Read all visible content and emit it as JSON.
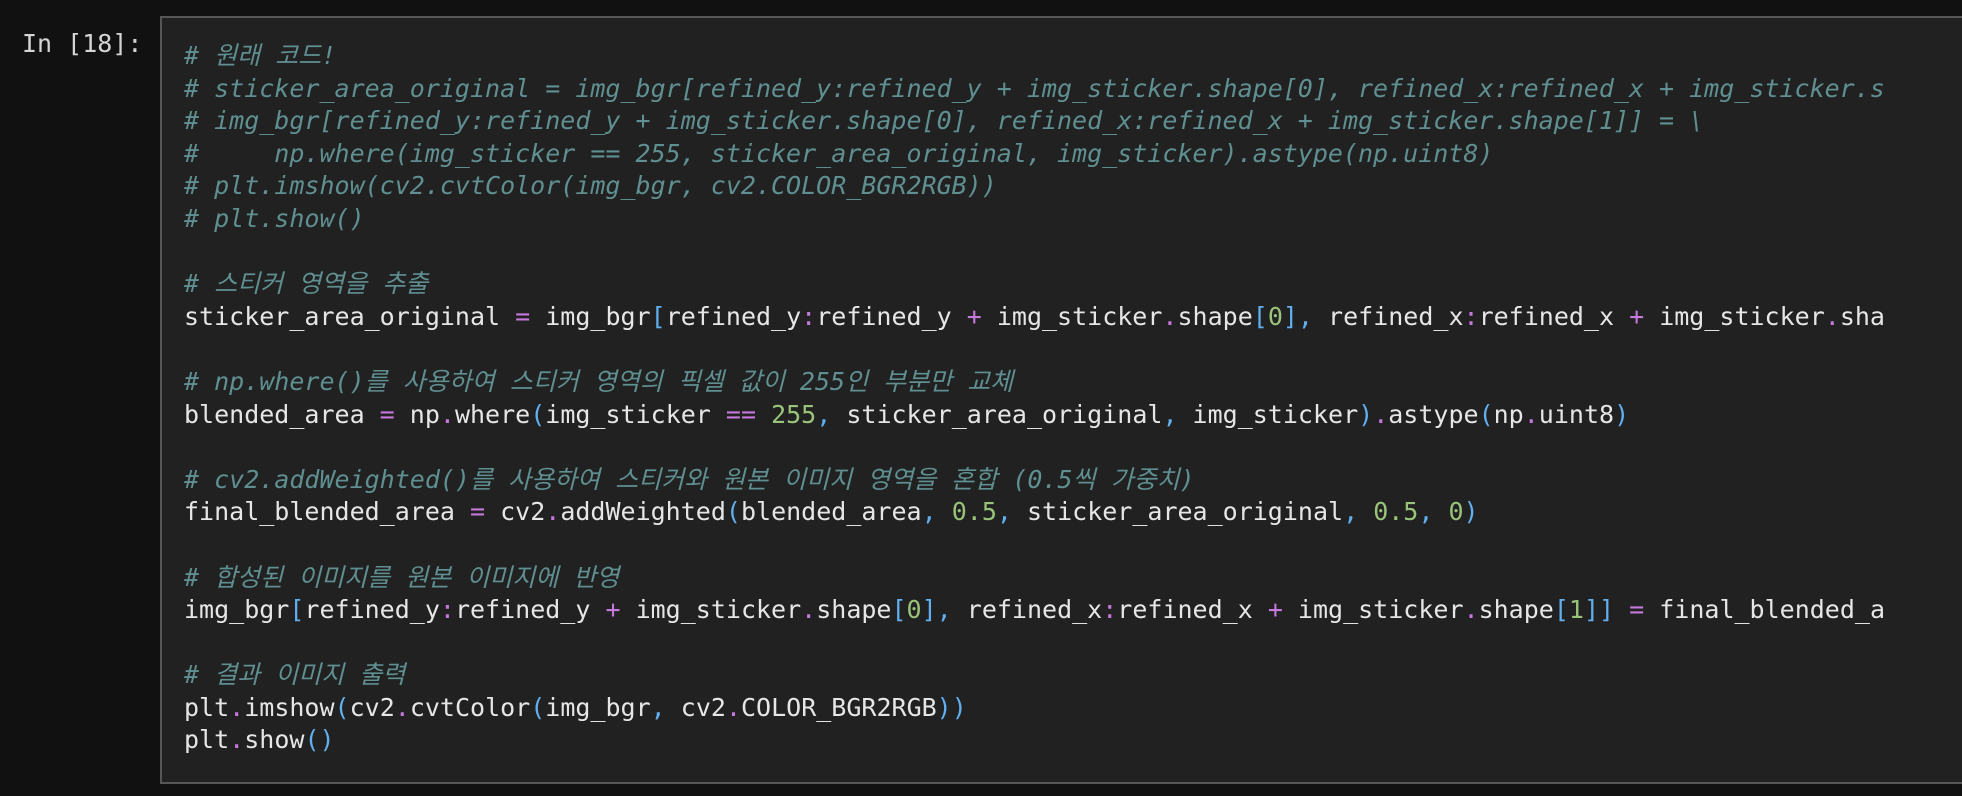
{
  "cell": {
    "prompt": "In [18]:",
    "lines": [
      [
        {
          "t": "# 원래 코드!",
          "c": "cm"
        }
      ],
      [
        {
          "t": "# sticker_area_original = img_bgr[refined_y:refined_y + img_sticker.shape[0], refined_x:refined_x + img_sticker.s",
          "c": "cm"
        }
      ],
      [
        {
          "t": "# img_bgr[refined_y:refined_y + img_sticker.shape[0], refined_x:refined_x + img_sticker.shape[1]] = \\",
          "c": "cm"
        }
      ],
      [
        {
          "t": "#     np.where(img_sticker == 255, sticker_area_original, img_sticker).astype(np.uint8)",
          "c": "cm"
        }
      ],
      [
        {
          "t": "# plt.imshow(cv2.cvtColor(img_bgr, cv2.COLOR_BGR2RGB))",
          "c": "cm"
        }
      ],
      [
        {
          "t": "# plt.show()",
          "c": "cm"
        }
      ],
      [],
      [
        {
          "t": "# 스티커 영역을 추출",
          "c": "cm"
        }
      ],
      [
        {
          "t": "sticker_area_original ",
          "c": ""
        },
        {
          "t": "=",
          "c": "op"
        },
        {
          "t": " img_bgr",
          "c": ""
        },
        {
          "t": "[",
          "c": "br"
        },
        {
          "t": "refined_y",
          "c": ""
        },
        {
          "t": ":",
          "c": "op"
        },
        {
          "t": "refined_y ",
          "c": ""
        },
        {
          "t": "+",
          "c": "op"
        },
        {
          "t": " img_sticker",
          "c": ""
        },
        {
          "t": ".",
          "c": "dot"
        },
        {
          "t": "shape",
          "c": ""
        },
        {
          "t": "[",
          "c": "br"
        },
        {
          "t": "0",
          "c": "num"
        },
        {
          "t": "],",
          "c": "br"
        },
        {
          "t": " refined_x",
          "c": ""
        },
        {
          "t": ":",
          "c": "op"
        },
        {
          "t": "refined_x ",
          "c": ""
        },
        {
          "t": "+",
          "c": "op"
        },
        {
          "t": " img_sticker",
          "c": ""
        },
        {
          "t": ".",
          "c": "dot"
        },
        {
          "t": "sha",
          "c": ""
        }
      ],
      [],
      [
        {
          "t": "# np.where()를 사용하여 스티커 영역의 픽셀 값이 255인 부분만 교체",
          "c": "cm"
        }
      ],
      [
        {
          "t": "blended_area ",
          "c": ""
        },
        {
          "t": "=",
          "c": "op"
        },
        {
          "t": " np",
          "c": ""
        },
        {
          "t": ".",
          "c": "dot"
        },
        {
          "t": "where",
          "c": ""
        },
        {
          "t": "(",
          "c": "br"
        },
        {
          "t": "img_sticker ",
          "c": ""
        },
        {
          "t": "==",
          "c": "op"
        },
        {
          "t": " ",
          "c": ""
        },
        {
          "t": "255",
          "c": "num"
        },
        {
          "t": ",",
          "c": "br"
        },
        {
          "t": " sticker_area_original",
          "c": ""
        },
        {
          "t": ",",
          "c": "br"
        },
        {
          "t": " img_sticker",
          "c": ""
        },
        {
          "t": ")",
          "c": "br"
        },
        {
          "t": ".",
          "c": "dot"
        },
        {
          "t": "astype",
          "c": ""
        },
        {
          "t": "(",
          "c": "br"
        },
        {
          "t": "np",
          "c": ""
        },
        {
          "t": ".",
          "c": "dot"
        },
        {
          "t": "uint8",
          "c": ""
        },
        {
          "t": ")",
          "c": "br"
        }
      ],
      [],
      [
        {
          "t": "# cv2.addWeighted()를 사용하여 스티커와 원본 이미지 영역을 혼합 (0.5씩 가중치)",
          "c": "cm"
        }
      ],
      [
        {
          "t": "final_blended_area ",
          "c": ""
        },
        {
          "t": "=",
          "c": "op"
        },
        {
          "t": " cv2",
          "c": ""
        },
        {
          "t": ".",
          "c": "dot"
        },
        {
          "t": "addWeighted",
          "c": ""
        },
        {
          "t": "(",
          "c": "br"
        },
        {
          "t": "blended_area",
          "c": ""
        },
        {
          "t": ",",
          "c": "br"
        },
        {
          "t": " ",
          "c": ""
        },
        {
          "t": "0.5",
          "c": "num"
        },
        {
          "t": ",",
          "c": "br"
        },
        {
          "t": " sticker_area_original",
          "c": ""
        },
        {
          "t": ",",
          "c": "br"
        },
        {
          "t": " ",
          "c": ""
        },
        {
          "t": "0.5",
          "c": "num"
        },
        {
          "t": ",",
          "c": "br"
        },
        {
          "t": " ",
          "c": ""
        },
        {
          "t": "0",
          "c": "num"
        },
        {
          "t": ")",
          "c": "br"
        }
      ],
      [],
      [
        {
          "t": "# 합성된 이미지를 원본 이미지에 반영",
          "c": "cm"
        }
      ],
      [
        {
          "t": "img_bgr",
          "c": ""
        },
        {
          "t": "[",
          "c": "br"
        },
        {
          "t": "refined_y",
          "c": ""
        },
        {
          "t": ":",
          "c": "op"
        },
        {
          "t": "refined_y ",
          "c": ""
        },
        {
          "t": "+",
          "c": "op"
        },
        {
          "t": " img_sticker",
          "c": ""
        },
        {
          "t": ".",
          "c": "dot"
        },
        {
          "t": "shape",
          "c": ""
        },
        {
          "t": "[",
          "c": "br"
        },
        {
          "t": "0",
          "c": "num"
        },
        {
          "t": "],",
          "c": "br"
        },
        {
          "t": " refined_x",
          "c": ""
        },
        {
          "t": ":",
          "c": "op"
        },
        {
          "t": "refined_x ",
          "c": ""
        },
        {
          "t": "+",
          "c": "op"
        },
        {
          "t": " img_sticker",
          "c": ""
        },
        {
          "t": ".",
          "c": "dot"
        },
        {
          "t": "shape",
          "c": ""
        },
        {
          "t": "[",
          "c": "br"
        },
        {
          "t": "1",
          "c": "num"
        },
        {
          "t": "]]",
          "c": "br"
        },
        {
          "t": " ",
          "c": ""
        },
        {
          "t": "=",
          "c": "op"
        },
        {
          "t": " final_blended_a",
          "c": ""
        }
      ],
      [],
      [
        {
          "t": "# 결과 이미지 출력",
          "c": "cm"
        }
      ],
      [
        {
          "t": "plt",
          "c": ""
        },
        {
          "t": ".",
          "c": "dot"
        },
        {
          "t": "imshow",
          "c": ""
        },
        {
          "t": "(",
          "c": "br"
        },
        {
          "t": "cv2",
          "c": ""
        },
        {
          "t": ".",
          "c": "dot"
        },
        {
          "t": "cvtColor",
          "c": ""
        },
        {
          "t": "(",
          "c": "br"
        },
        {
          "t": "img_bgr",
          "c": ""
        },
        {
          "t": ",",
          "c": "br"
        },
        {
          "t": " cv2",
          "c": ""
        },
        {
          "t": ".",
          "c": "dot"
        },
        {
          "t": "COLOR_BGR2RGB",
          "c": ""
        },
        {
          "t": "))",
          "c": "br"
        }
      ],
      [
        {
          "t": "plt",
          "c": ""
        },
        {
          "t": ".",
          "c": "dot"
        },
        {
          "t": "show",
          "c": ""
        },
        {
          "t": "()",
          "c": "br"
        }
      ]
    ]
  },
  "colors": {
    "background": "#111111",
    "cell_background": "#212121",
    "cell_border": "#565656",
    "comment": "#5f8f90",
    "operator": "#c678dd",
    "bracket": "#61afef",
    "number": "#98c379",
    "text": "#e6e6e6"
  }
}
